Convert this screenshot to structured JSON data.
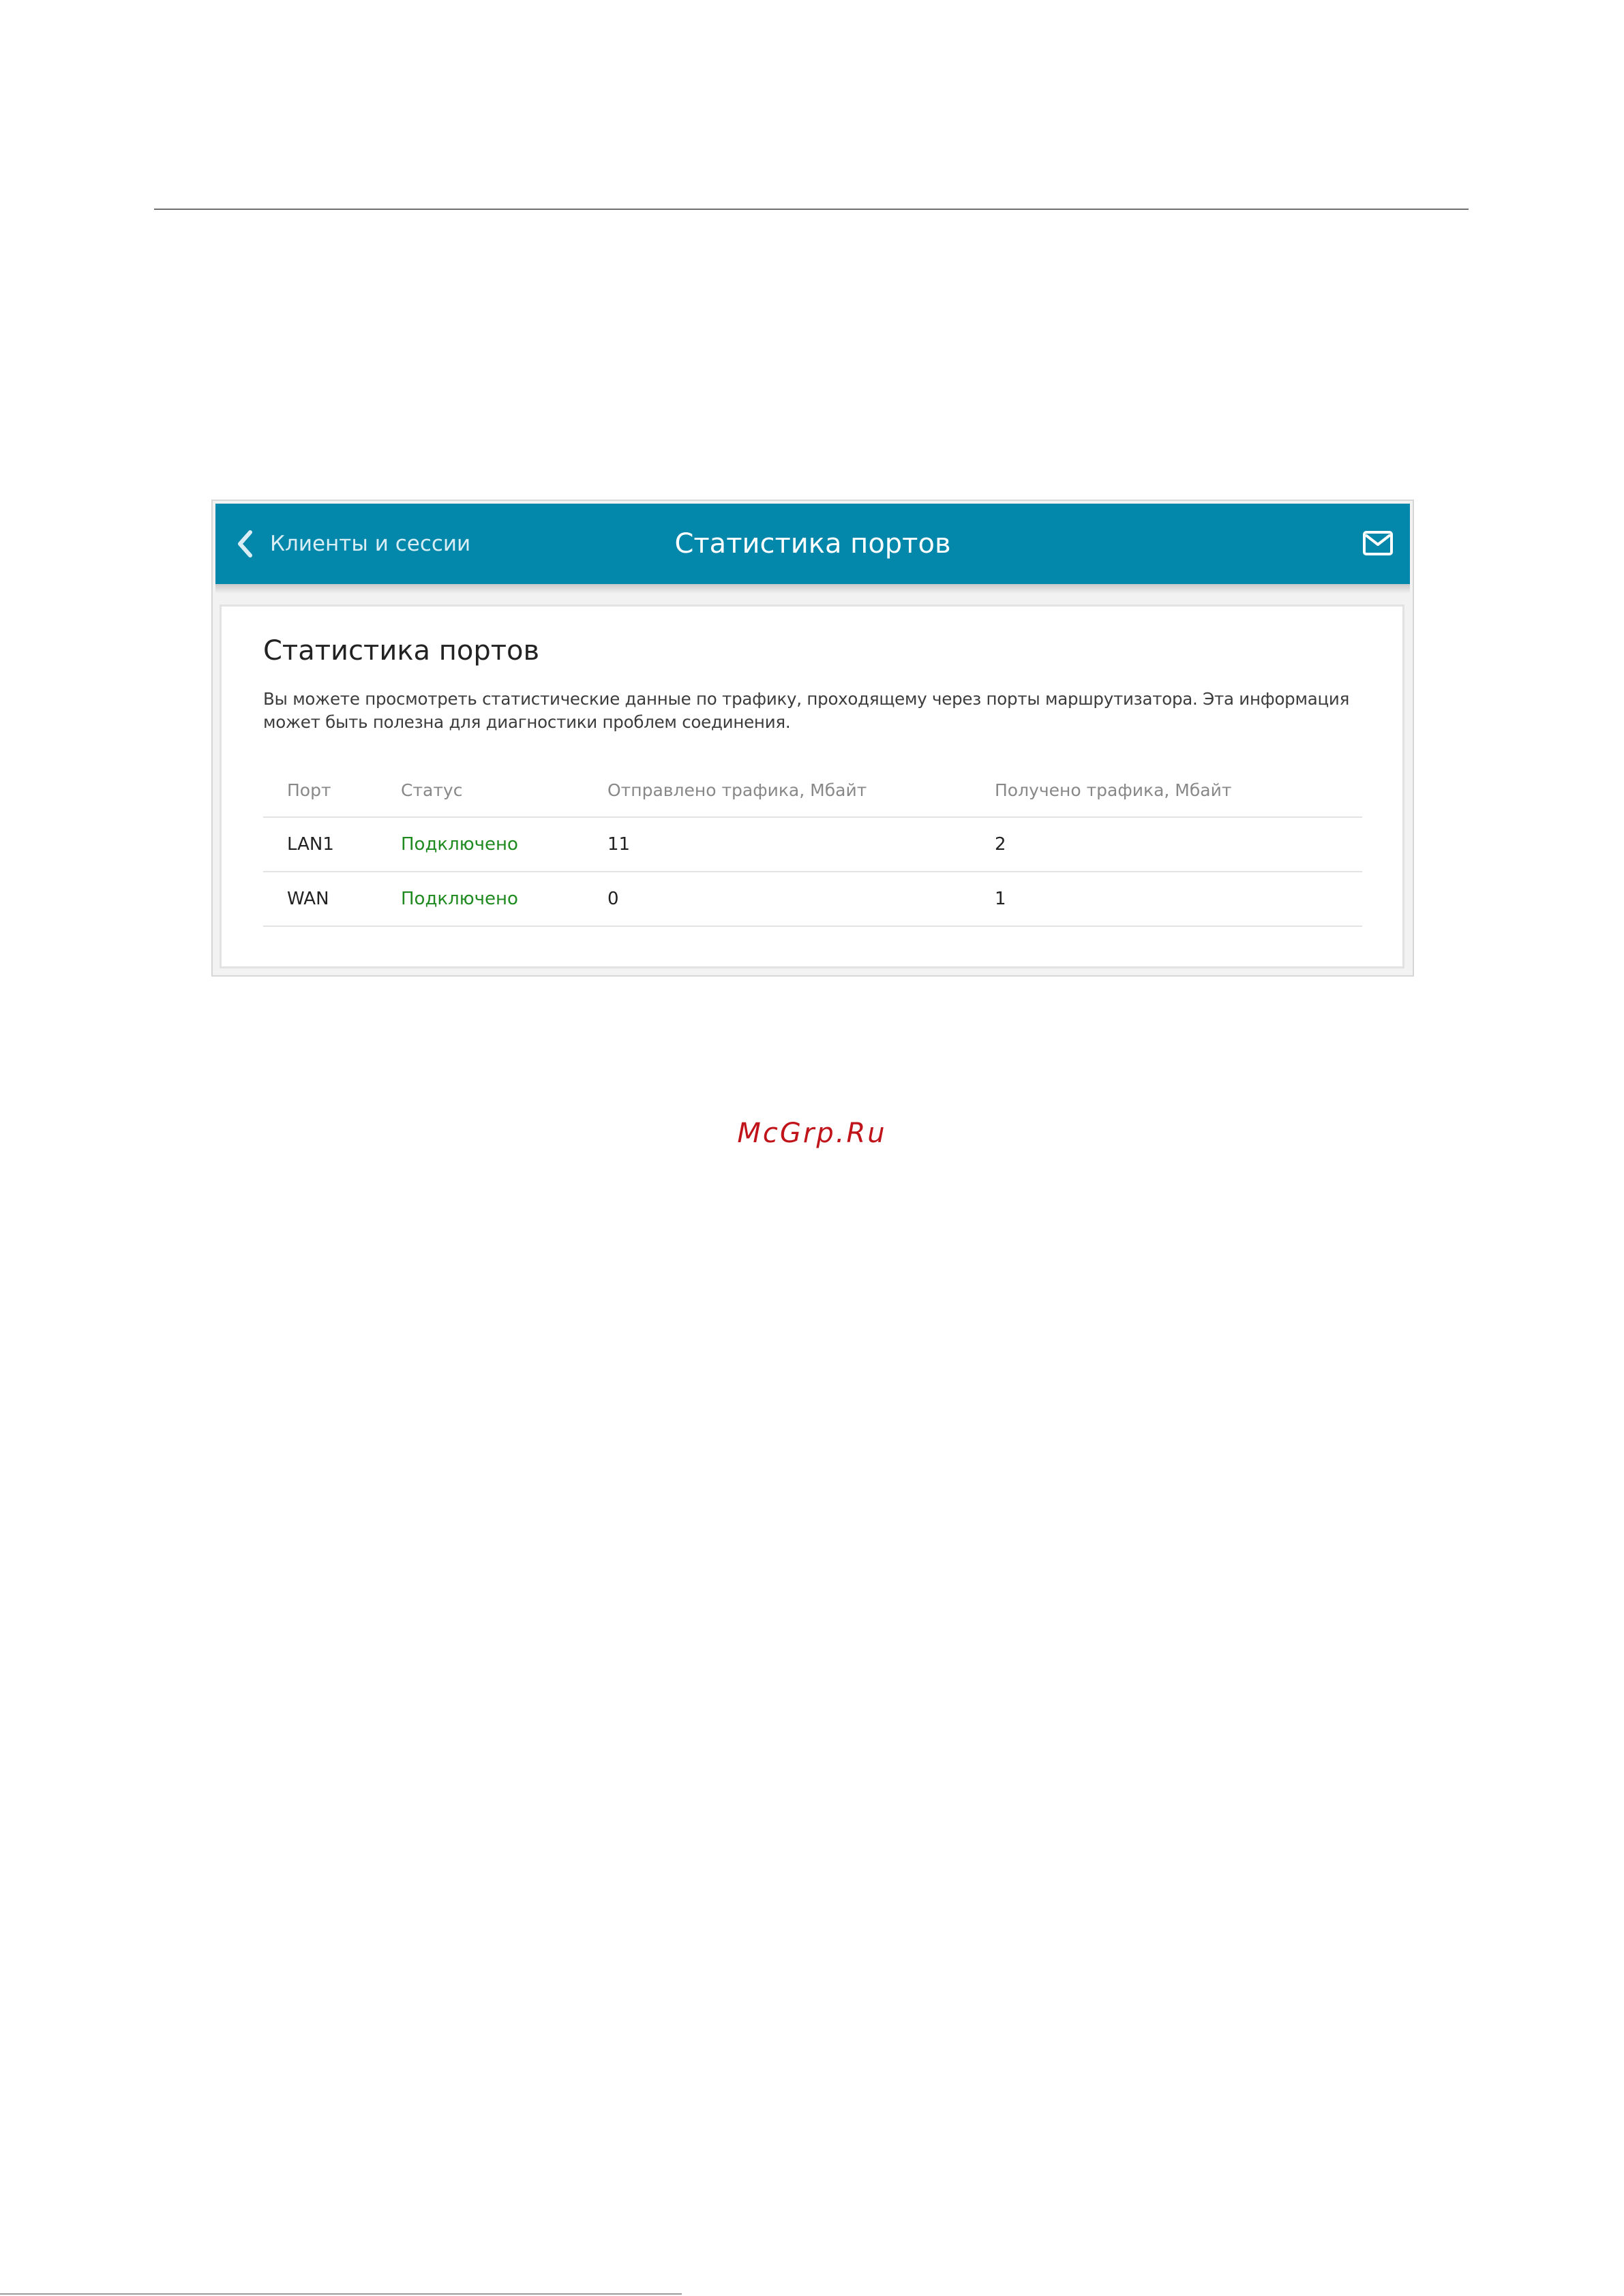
{
  "header": {
    "back_label": "Клиенты и сессии",
    "title": "Статистика портов",
    "accent_color": "#0387ab",
    "back_icon": "chevron-left-icon",
    "mail_icon": "mail-icon"
  },
  "card": {
    "title": "Статистика портов",
    "description": "Вы можете просмотреть статистические данные по трафику, проходящему через порты маршрутизатора. Эта информация может быть полезна для диагностики проблем соединения."
  },
  "table": {
    "columns": [
      "Порт",
      "Статус",
      "Отправлено трафика, Мбайт",
      "Получено трафика, Мбайт"
    ],
    "rows": [
      {
        "port": "LAN1",
        "status": "Подключено",
        "sent": "11",
        "received": "2"
      },
      {
        "port": "WAN",
        "status": "Подключено",
        "sent": "0",
        "received": "1"
      }
    ],
    "status_color": "#1f8a1f"
  },
  "watermark": "McGrp.Ru"
}
